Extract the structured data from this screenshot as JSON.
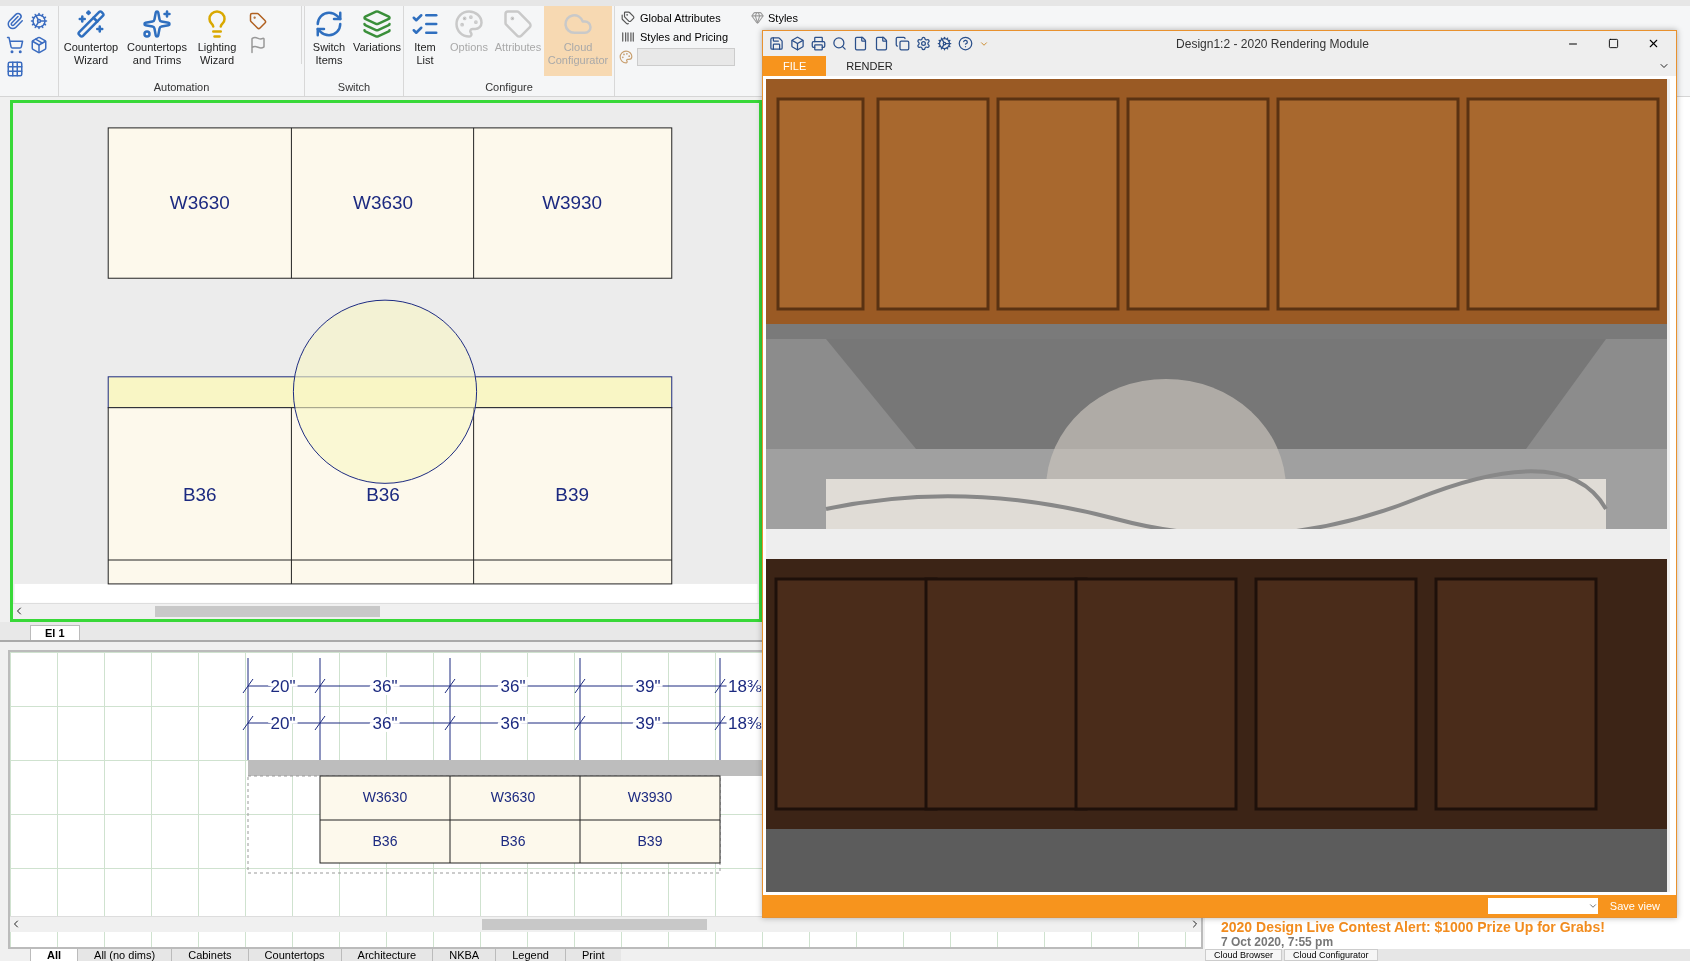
{
  "ribbon": {
    "groups": [
      {
        "label": "Automation",
        "buttons": [
          {
            "label": "Countertop Wizard",
            "disabled": false,
            "highlighted": false
          },
          {
            "label": "Countertops and Trims",
            "disabled": false,
            "highlighted": false
          },
          {
            "label": "Lighting Wizard",
            "disabled": false,
            "highlighted": false
          }
        ]
      },
      {
        "label": "Switch",
        "buttons": [
          {
            "label": "Switch Items",
            "disabled": false,
            "highlighted": false
          },
          {
            "label": "Variations",
            "disabled": false,
            "highlighted": false
          }
        ]
      },
      {
        "label": "Configure",
        "buttons": [
          {
            "label": "Item List",
            "disabled": false,
            "highlighted": false
          },
          {
            "label": "Options",
            "disabled": true,
            "highlighted": false
          },
          {
            "label": "Attributes",
            "disabled": true,
            "highlighted": false
          },
          {
            "label": "Cloud Configurator",
            "disabled": true,
            "highlighted": true
          }
        ]
      }
    ],
    "side_commands": [
      {
        "label": "Global Attributes"
      },
      {
        "label": "Styles and Pricing"
      }
    ],
    "styles_button": "Styles"
  },
  "elevation": {
    "upper": [
      "W3630",
      "W3630",
      "W3930"
    ],
    "base": [
      "B36",
      "B36",
      "B39"
    ]
  },
  "elevation_tabs": [
    {
      "label": "El 1",
      "selected": true
    }
  ],
  "plan": {
    "dimension_rows": [
      [
        "20\"",
        "36\"",
        "36\"",
        "39\"",
        "18⅜"
      ],
      [
        "20\"",
        "36\"",
        "36\"",
        "39\"",
        "18⅜"
      ]
    ],
    "upper": [
      "W3630",
      "W3630",
      "W3930"
    ],
    "base": [
      "B36",
      "B36",
      "B39"
    ]
  },
  "view_tabs": [
    {
      "label": "All",
      "selected": true
    },
    {
      "label": "All (no dims)",
      "selected": false
    },
    {
      "label": "Cabinets",
      "selected": false
    },
    {
      "label": "Countertops",
      "selected": false
    },
    {
      "label": "Architecture",
      "selected": false
    },
    {
      "label": "NKBA",
      "selected": false
    },
    {
      "label": "Legend",
      "selected": false
    },
    {
      "label": "Print",
      "selected": false
    }
  ],
  "render_window": {
    "title": "Design1:2 - 2020 Rendering Module",
    "tabs": [
      {
        "label": "FILE",
        "selected": true
      },
      {
        "label": "RENDER",
        "selected": false
      }
    ],
    "save_view": "Save view"
  },
  "news": {
    "headline": "2020 Design Live Contest Alert: $1000 Prize Up for Grabs!",
    "date": "7 Oct 2020, 7:55 pm",
    "tabs": [
      {
        "label": "Cloud Browser"
      },
      {
        "label": "Cloud Configurator"
      }
    ]
  }
}
